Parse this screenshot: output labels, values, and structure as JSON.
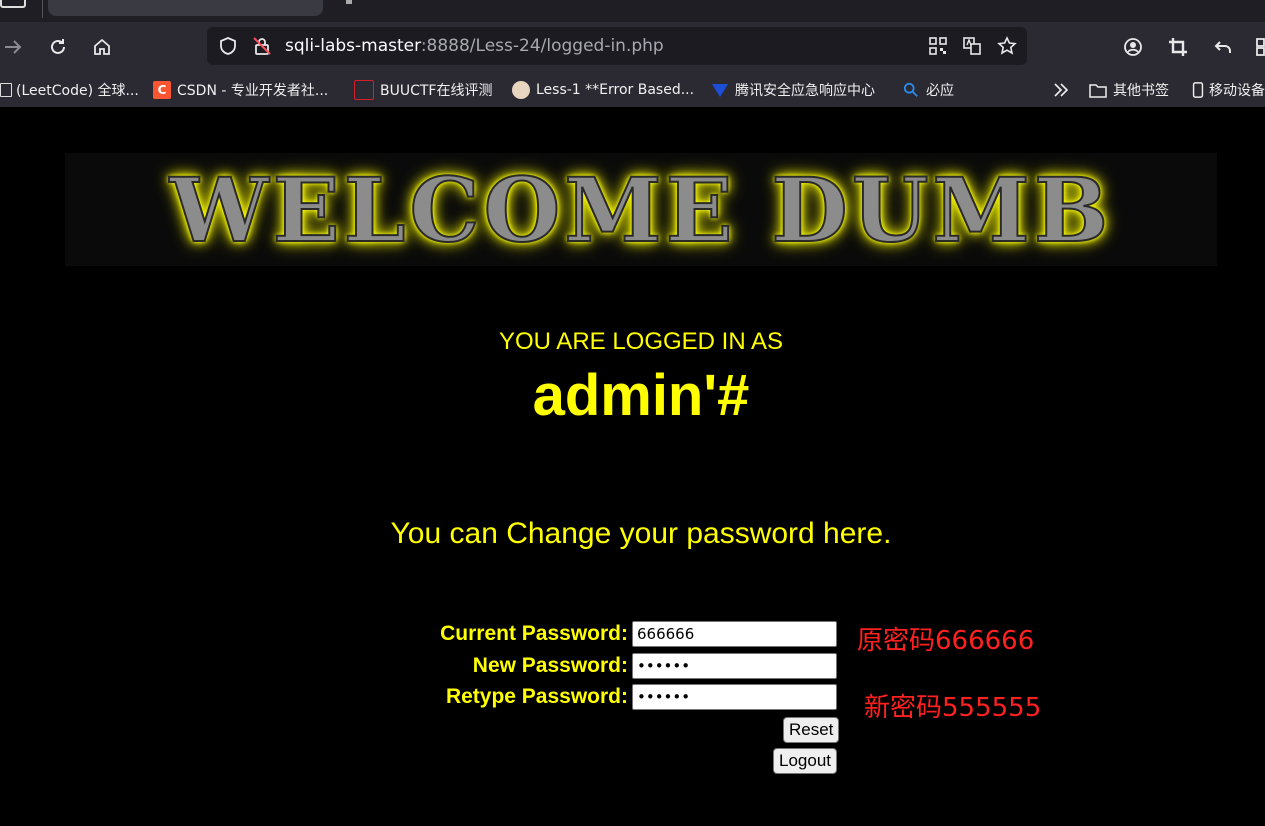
{
  "browser": {
    "url_host": "sqli-labs-master",
    "url_rest": ":8888/Less-24/logged-in.php",
    "bookmarks": [
      {
        "icon": "leetcode-icon",
        "label": "(LeetCode) 全球..."
      },
      {
        "icon": "csdn-icon",
        "glyph": "C",
        "color": "#fc5531",
        "label": "CSDN - 专业开发者社..."
      },
      {
        "icon": "buuctf-icon",
        "label": "BUUCTF在线评测"
      },
      {
        "icon": "avatar-icon",
        "label": "Less-1 **Error Based..."
      },
      {
        "icon": "tencent-icon",
        "label": "腾讯安全应急响应中心"
      },
      {
        "icon": "bing-search-icon",
        "label": "必应"
      }
    ],
    "folder_other": "其他书签",
    "folder_mobile": "移动设备"
  },
  "page": {
    "banner": "WELCOME DUMB",
    "logged_label": "YOU ARE LOGGED IN AS",
    "username": "admin'#",
    "change_msg": "You can Change your password here.",
    "form": {
      "current_label": "Current Password:",
      "current_value": "666666",
      "new_label": "New Password:",
      "new_value": "555555",
      "retype_label": "Retype Password:",
      "retype_value": "555555",
      "reset_label": "Reset",
      "logout_label": "Logout"
    },
    "annotations": {
      "old_password": "原密码666666",
      "new_password": "新密码555555"
    },
    "colors": {
      "text": "#ffff00",
      "annotation": "#ff2020",
      "background": "#000000"
    }
  }
}
